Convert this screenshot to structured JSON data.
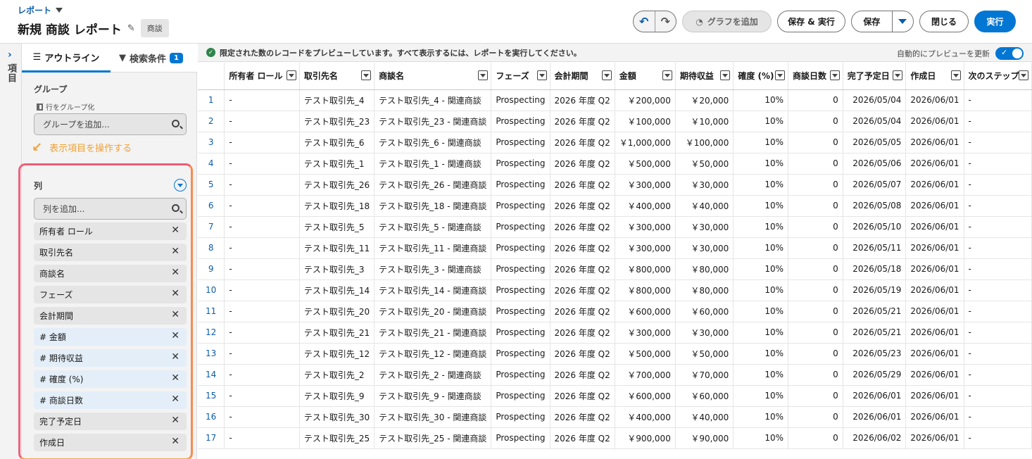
{
  "header": {
    "breadcrumb": "レポート",
    "title": "新規 商談 レポート",
    "type_tag": "商談",
    "buttons": {
      "add_chart": "グラフを追加",
      "save_run": "保存 & 実行",
      "save": "保存",
      "close": "閉じる",
      "run": "実行"
    }
  },
  "rail": {
    "label": "項目"
  },
  "panel": {
    "tab_outline": "アウトライン",
    "tab_filters": "検索条件",
    "filter_count": "1",
    "group_label": "グループ",
    "group_rows_label": "行をグループ化",
    "group_placeholder": "グループを追加...",
    "annotation": "表示項目を操作する",
    "columns_label": "列",
    "column_placeholder": "列を追加...",
    "columns": [
      {
        "label": "所有者 ロール",
        "numeric": false
      },
      {
        "label": "取引先名",
        "numeric": false
      },
      {
        "label": "商談名",
        "numeric": false
      },
      {
        "label": "フェーズ",
        "numeric": false
      },
      {
        "label": "会計期間",
        "numeric": false
      },
      {
        "label": "# 金額",
        "numeric": true
      },
      {
        "label": "# 期待収益",
        "numeric": true
      },
      {
        "label": "# 確度 (%)",
        "numeric": true
      },
      {
        "label": "# 商談日数",
        "numeric": true
      },
      {
        "label": "完了予定日",
        "numeric": false
      },
      {
        "label": "作成日",
        "numeric": false
      }
    ]
  },
  "notice": {
    "text": "限定された数のレコードをプレビューしています。すべて表示するには、レポートを実行してください。",
    "auto_preview": "自動的にプレビューを更新"
  },
  "table": {
    "headers": [
      "所有者 ロール",
      "取引先名",
      "商談名",
      "フェーズ",
      "会計期間",
      "金額",
      "期待収益",
      "確度 (%)",
      "商談日数",
      "完了予定日",
      "作成日",
      "次のステップ"
    ],
    "rows": [
      [
        "1",
        "-",
        "テスト取引先_4",
        "テスト取引先_4 - 関連商談",
        "Prospecting",
        "2026 年度 Q2",
        "￥200,000",
        "￥20,000",
        "10%",
        "0",
        "2026/05/04",
        "2026/06/01",
        "-"
      ],
      [
        "2",
        "-",
        "テスト取引先_23",
        "テスト取引先_23 - 関連商談",
        "Prospecting",
        "2026 年度 Q2",
        "￥100,000",
        "￥10,000",
        "10%",
        "0",
        "2026/05/04",
        "2026/06/01",
        "-"
      ],
      [
        "3",
        "-",
        "テスト取引先_6",
        "テスト取引先_6 - 関連商談",
        "Prospecting",
        "2026 年度 Q2",
        "￥1,000,000",
        "￥100,000",
        "10%",
        "0",
        "2026/05/05",
        "2026/06/01",
        "-"
      ],
      [
        "4",
        "-",
        "テスト取引先_1",
        "テスト取引先_1 - 関連商談",
        "Prospecting",
        "2026 年度 Q2",
        "￥500,000",
        "￥50,000",
        "10%",
        "0",
        "2026/05/06",
        "2026/06/01",
        "-"
      ],
      [
        "5",
        "-",
        "テスト取引先_26",
        "テスト取引先_26 - 関連商談",
        "Prospecting",
        "2026 年度 Q2",
        "￥300,000",
        "￥30,000",
        "10%",
        "0",
        "2026/05/07",
        "2026/06/01",
        "-"
      ],
      [
        "6",
        "-",
        "テスト取引先_18",
        "テスト取引先_18 - 関連商談",
        "Prospecting",
        "2026 年度 Q2",
        "￥400,000",
        "￥40,000",
        "10%",
        "0",
        "2026/05/08",
        "2026/06/01",
        "-"
      ],
      [
        "7",
        "-",
        "テスト取引先_5",
        "テスト取引先_5 - 関連商談",
        "Prospecting",
        "2026 年度 Q2",
        "￥300,000",
        "￥30,000",
        "10%",
        "0",
        "2026/05/10",
        "2026/06/01",
        "-"
      ],
      [
        "8",
        "-",
        "テスト取引先_11",
        "テスト取引先_11 - 関連商談",
        "Prospecting",
        "2026 年度 Q2",
        "￥300,000",
        "￥30,000",
        "10%",
        "0",
        "2026/05/11",
        "2026/06/01",
        "-"
      ],
      [
        "9",
        "-",
        "テスト取引先_3",
        "テスト取引先_3 - 関連商談",
        "Prospecting",
        "2026 年度 Q2",
        "￥800,000",
        "￥80,000",
        "10%",
        "0",
        "2026/05/18",
        "2026/06/01",
        "-"
      ],
      [
        "10",
        "-",
        "テスト取引先_14",
        "テスト取引先_14 - 関連商談",
        "Prospecting",
        "2026 年度 Q2",
        "￥800,000",
        "￥80,000",
        "10%",
        "0",
        "2026/05/19",
        "2026/06/01",
        "-"
      ],
      [
        "11",
        "-",
        "テスト取引先_20",
        "テスト取引先_20 - 関連商談",
        "Prospecting",
        "2026 年度 Q2",
        "￥600,000",
        "￥60,000",
        "10%",
        "0",
        "2026/05/21",
        "2026/06/01",
        "-"
      ],
      [
        "12",
        "-",
        "テスト取引先_21",
        "テスト取引先_21 - 関連商談",
        "Prospecting",
        "2026 年度 Q2",
        "￥300,000",
        "￥30,000",
        "10%",
        "0",
        "2026/05/21",
        "2026/06/01",
        "-"
      ],
      [
        "13",
        "-",
        "テスト取引先_12",
        "テスト取引先_12 - 関連商談",
        "Prospecting",
        "2026 年度 Q2",
        "￥500,000",
        "￥50,000",
        "10%",
        "0",
        "2026/05/23",
        "2026/06/01",
        "-"
      ],
      [
        "14",
        "-",
        "テスト取引先_2",
        "テスト取引先_2 - 関連商談",
        "Prospecting",
        "2026 年度 Q2",
        "￥700,000",
        "￥70,000",
        "10%",
        "0",
        "2026/05/29",
        "2026/06/01",
        "-"
      ],
      [
        "15",
        "-",
        "テスト取引先_9",
        "テスト取引先_9 - 関連商談",
        "Prospecting",
        "2026 年度 Q2",
        "￥600,000",
        "￥60,000",
        "10%",
        "0",
        "2026/06/01",
        "2026/06/01",
        "-"
      ],
      [
        "16",
        "-",
        "テスト取引先_30",
        "テスト取引先_30 - 関連商談",
        "Prospecting",
        "2026 年度 Q2",
        "￥400,000",
        "￥40,000",
        "10%",
        "0",
        "2026/06/01",
        "2026/06/01",
        "-"
      ],
      [
        "17",
        "-",
        "テスト取引先_25",
        "テスト取引先_25 - 関連商談",
        "Prospecting",
        "2026 年度 Q2",
        "￥900,000",
        "￥90,000",
        "10%",
        "0",
        "2026/06/02",
        "2026/06/01",
        "-"
      ]
    ]
  }
}
